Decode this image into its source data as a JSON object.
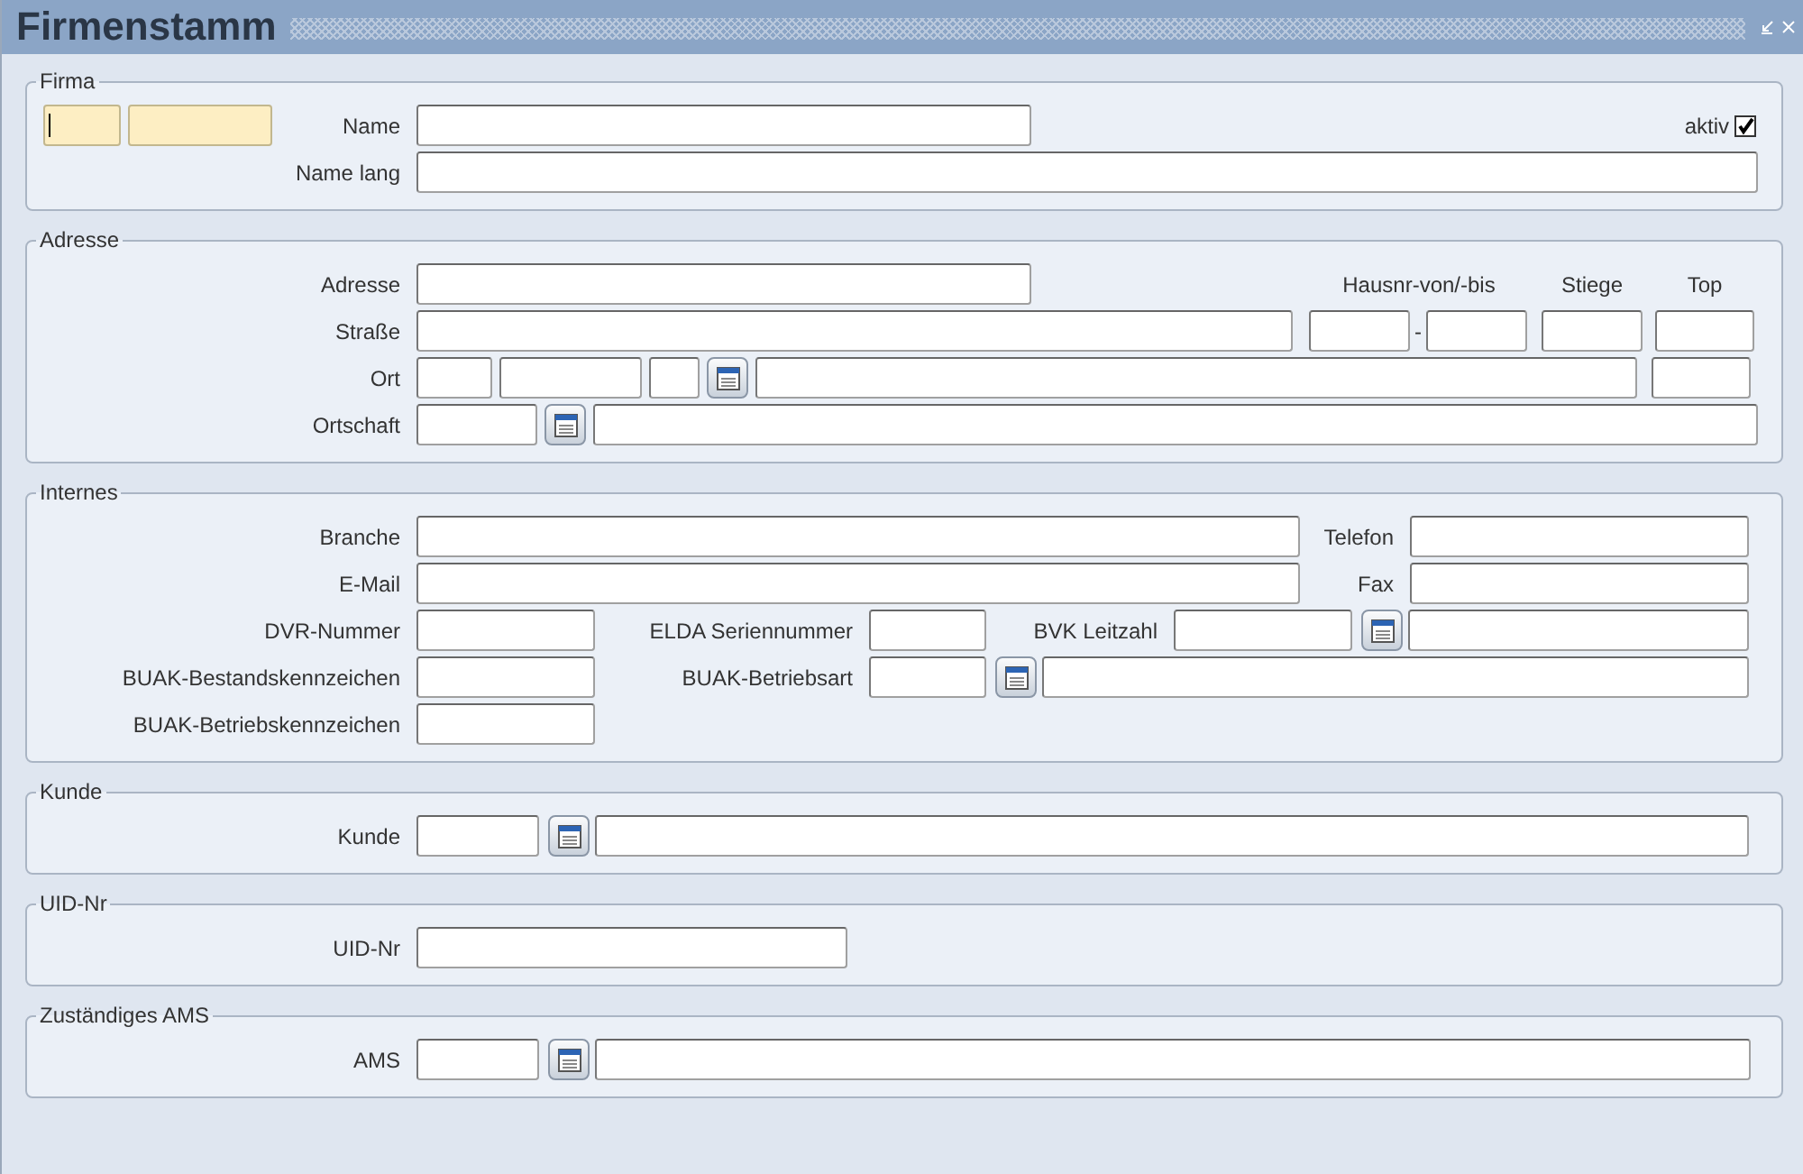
{
  "window": {
    "title": "Firmenstamm"
  },
  "firma": {
    "title": "Firma",
    "id_fields": [
      {
        "required": true,
        "focused": true
      },
      {
        "required": true,
        "focused": false
      }
    ],
    "labels": [
      "Name",
      "Name lang"
    ],
    "aktiv": {
      "label": "aktiv",
      "checked": true
    }
  },
  "adresse": {
    "title": "Adresse",
    "labels": [
      "Adresse",
      "Straße",
      "Ort",
      "Ortschaft"
    ],
    "headers": [
      "Hausnr-von/-bis",
      "Stiege",
      "Top"
    ],
    "separator": "-"
  },
  "internes": {
    "title": "Internes",
    "labels": [
      "Branche",
      "Telefon",
      "E-Mail",
      "Fax",
      "DVR-Nummer",
      "ELDA Seriennummer",
      "BVK Leitzahl",
      "BUAK-Bestandskennzeichen",
      "BUAK-Betriebsart",
      "BUAK-Betriebskennzeichen"
    ]
  },
  "kunde": {
    "title": "Kunde",
    "label": "Kunde"
  },
  "uid": {
    "title": "UID-Nr",
    "label": "UID-Nr"
  },
  "ams": {
    "title": "Zuständiges AMS",
    "label": "AMS"
  }
}
